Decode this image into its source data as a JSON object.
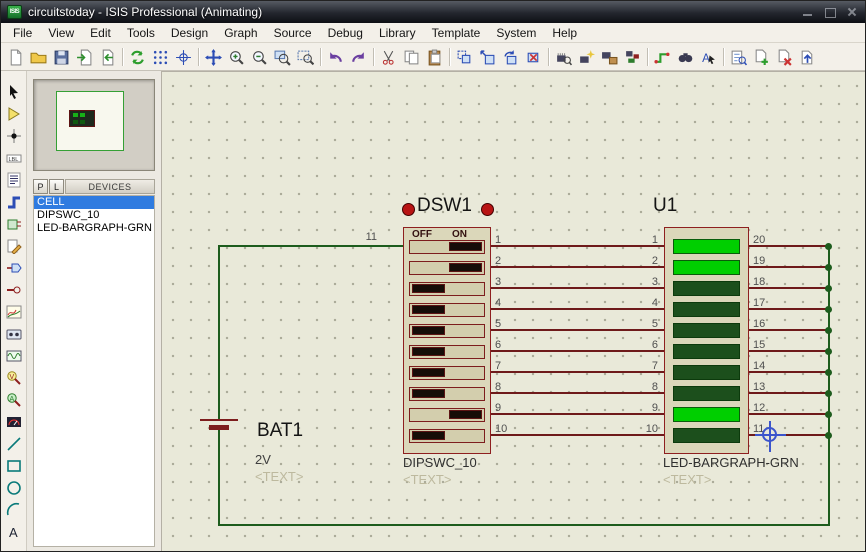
{
  "window": {
    "title": "circuitstoday - ISIS Professional (Animating)",
    "app_icon": "ISIS"
  },
  "menu": {
    "items": [
      "File",
      "View",
      "Edit",
      "Tools",
      "Design",
      "Graph",
      "Source",
      "Debug",
      "Library",
      "Template",
      "System",
      "Help"
    ]
  },
  "sidebar": {
    "pick_button": "P",
    "library_button": "L",
    "devices_header": "DEVICES",
    "devices": [
      {
        "name": "CELL",
        "selected": true
      },
      {
        "name": "DIPSWC_10",
        "selected": false
      },
      {
        "name": "LED-BARGRAPH-GRN",
        "selected": false
      }
    ]
  },
  "circuit": {
    "dsw1": {
      "ref": "DSW1",
      "off": "OFF",
      "on": "ON",
      "part": "DIPSWC_10",
      "text": "<TEXT>",
      "common_pin": "11"
    },
    "u1": {
      "ref": "U1",
      "part": "LED-BARGRAPH-GRN",
      "text": "<TEXT>"
    },
    "bat1": {
      "ref": "BAT1",
      "value": "2V",
      "text": "<TEXT>"
    },
    "rows": [
      {
        "dsw_pin": "1",
        "u1_left": "1",
        "u1_right": "20",
        "sw_on": true,
        "led_on": true
      },
      {
        "dsw_pin": "2",
        "u1_left": "2",
        "u1_right": "19",
        "sw_on": true,
        "led_on": true
      },
      {
        "dsw_pin": "3",
        "u1_left": "3",
        "u1_right": "18",
        "sw_on": false,
        "led_on": false
      },
      {
        "dsw_pin": "4",
        "u1_left": "4",
        "u1_right": "17",
        "sw_on": false,
        "led_on": false
      },
      {
        "dsw_pin": "5",
        "u1_left": "5",
        "u1_right": "16",
        "sw_on": false,
        "led_on": false
      },
      {
        "dsw_pin": "6",
        "u1_left": "6",
        "u1_right": "15",
        "sw_on": false,
        "led_on": false
      },
      {
        "dsw_pin": "7",
        "u1_left": "7",
        "u1_right": "14",
        "sw_on": false,
        "led_on": false
      },
      {
        "dsw_pin": "8",
        "u1_left": "8",
        "u1_right": "13",
        "sw_on": false,
        "led_on": false
      },
      {
        "dsw_pin": "9",
        "u1_left": "9",
        "u1_right": "12",
        "sw_on": true,
        "led_on": true
      },
      {
        "dsw_pin": "10",
        "u1_left": "10",
        "u1_right": "11",
        "sw_on": false,
        "led_on": false
      }
    ]
  },
  "colors": {
    "led_on": "#00cf00",
    "led_off": "#1c4f1c",
    "wire_green": "#1d5c1d",
    "pin_red": "#6e1a1a",
    "selection_blue": "#2f7be0"
  }
}
